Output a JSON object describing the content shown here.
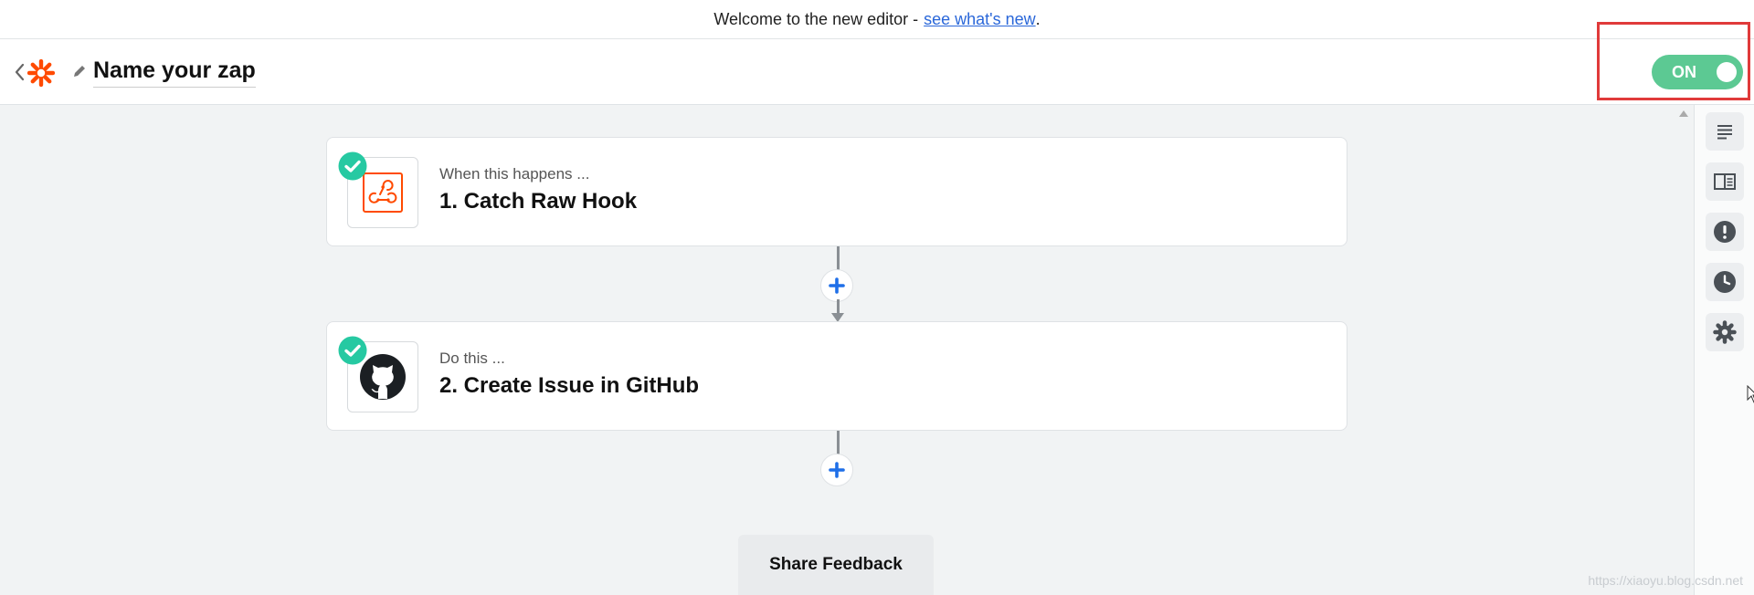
{
  "banner": {
    "text": "Welcome to the new editor - ",
    "link": "see what's new",
    "period": "."
  },
  "header": {
    "zap_name": "Name your zap",
    "toggle_label": "ON",
    "toggle_state": "on",
    "toggle_color": "#5cc993"
  },
  "steps": [
    {
      "label": "When this happens ...",
      "title": "1. Catch Raw Hook",
      "icon": "webhook-icon",
      "icon_color": "#ff4a00"
    },
    {
      "label": "Do this ...",
      "title": "2. Create Issue in GitHub",
      "icon": "github-icon",
      "icon_color": "#1b1f23"
    }
  ],
  "feedback": {
    "label": "Share Feedback"
  },
  "rail": [
    "notes-icon",
    "book-icon",
    "alert-icon",
    "history-icon",
    "settings-icon"
  ],
  "watermark": "https://xiaoyu.blog.csdn.net",
  "colors": {
    "accent": "#ff4a00",
    "check": "#26c9a2",
    "plus": "#1f6fe8",
    "highlight": "#e03a3a"
  }
}
